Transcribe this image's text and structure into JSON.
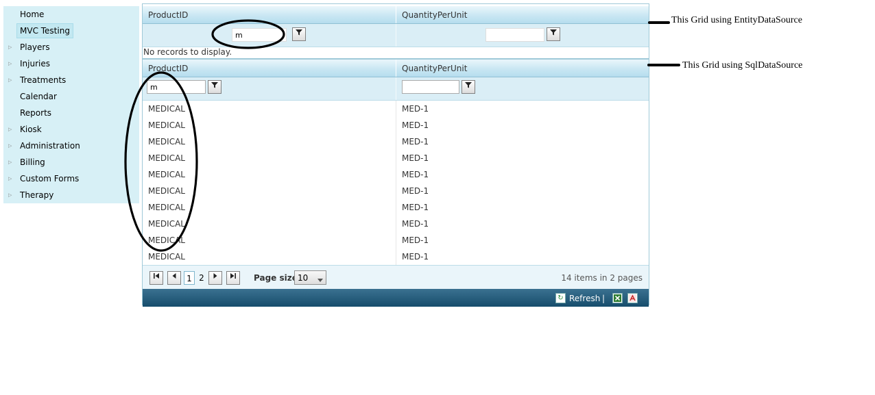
{
  "sidebar": {
    "items": [
      {
        "label": "Home",
        "expandable": false,
        "selected": false
      },
      {
        "label": "MVC Testing",
        "expandable": false,
        "selected": true
      },
      {
        "label": "Players",
        "expandable": true,
        "selected": false
      },
      {
        "label": "Injuries",
        "expandable": true,
        "selected": false
      },
      {
        "label": "Treatments",
        "expandable": true,
        "selected": false
      },
      {
        "label": "Calendar",
        "expandable": false,
        "selected": false
      },
      {
        "label": "Reports",
        "expandable": false,
        "selected": false
      },
      {
        "label": "Kiosk",
        "expandable": true,
        "selected": false
      },
      {
        "label": "Administration",
        "expandable": true,
        "selected": false
      },
      {
        "label": "Billing",
        "expandable": true,
        "selected": false
      },
      {
        "label": "Custom Forms",
        "expandable": true,
        "selected": false
      },
      {
        "label": "Therapy",
        "expandable": true,
        "selected": false
      }
    ],
    "expand_icon": "triangle-right-icon"
  },
  "grid1": {
    "columns": [
      "ProductID",
      "QuantityPerUnit"
    ],
    "filters": [
      "m",
      ""
    ],
    "filter_icon": "funnel-icon",
    "no_records": "No records to display."
  },
  "grid2": {
    "columns": [
      "ProductID",
      "QuantityPerUnit"
    ],
    "filters": [
      "m",
      ""
    ],
    "filter_icon": "funnel-icon",
    "rows": [
      [
        "MEDICAL",
        "MED-1"
      ],
      [
        "MEDICAL",
        "MED-1"
      ],
      [
        "MEDICAL",
        "MED-1"
      ],
      [
        "MEDICAL",
        "MED-1"
      ],
      [
        "MEDICAL",
        "MED-1"
      ],
      [
        "MEDICAL",
        "MED-1"
      ],
      [
        "MEDICAL",
        "MED-1"
      ],
      [
        "MEDICAL",
        "MED-1"
      ],
      [
        "MEDICAL",
        "MED-1"
      ],
      [
        "MEDICAL",
        "MED-1"
      ]
    ],
    "pager": {
      "pages": [
        "1",
        "2"
      ],
      "current_page": "1",
      "page_size_label": "Page size:",
      "page_size": "10",
      "summary": "14 items in 2 pages"
    },
    "footer": {
      "refresh_label": "Refresh",
      "separator": "|",
      "icons": [
        "refresh-icon",
        "export-excel-icon",
        "export-pdf-icon"
      ]
    }
  },
  "annotations": {
    "entity": "This Grid using EntityDataSource",
    "sql": "This Grid using SqlDataSource"
  },
  "colors": {
    "sidebar_bg": "#d7f0f6",
    "header_gradient": "#c9e7f3",
    "footer_bg": "#1f5678"
  }
}
